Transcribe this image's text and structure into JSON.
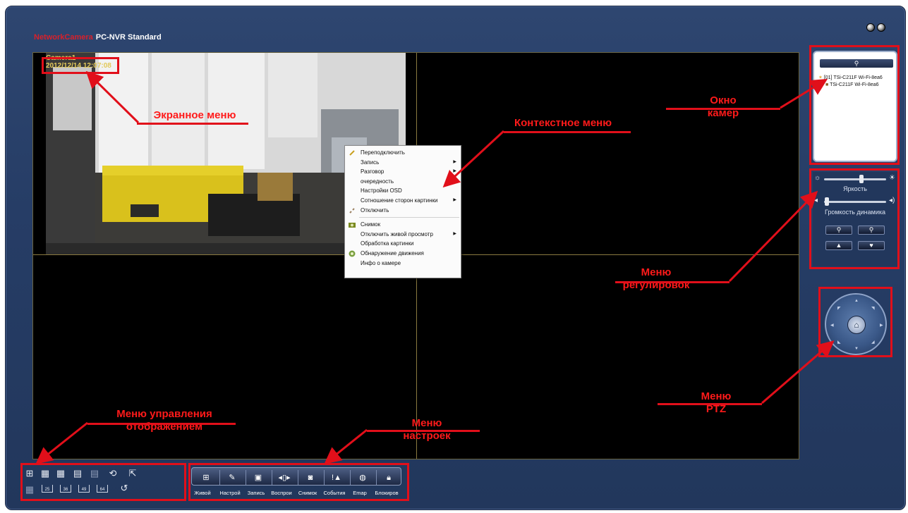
{
  "app": {
    "brand_red": "NetworkCamera",
    "brand_white": "PC-NVR Standard"
  },
  "osd": {
    "camera_name": "Camera1",
    "datetime": "2012/12/14 12:07:08"
  },
  "context_menu": {
    "items": [
      {
        "label": "Переподключить",
        "icon": "link-icon",
        "submenu": false
      },
      {
        "label": "Запись",
        "icon": "",
        "submenu": true
      },
      {
        "label": "Разговор",
        "icon": "",
        "submenu": true
      },
      {
        "label": "очередность",
        "icon": "",
        "submenu": true
      },
      {
        "label": "Настройки OSD",
        "icon": "",
        "submenu": false
      },
      {
        "label": "Сотношение сторон картинки",
        "icon": "",
        "submenu": true
      },
      {
        "label": "Отключить",
        "icon": "unlink-icon",
        "submenu": false
      },
      {
        "label": "Снимок",
        "icon": "camera-icon",
        "submenu": false
      },
      {
        "label": "Отключить живой просмотр",
        "icon": "",
        "submenu": true
      },
      {
        "label": "Обработка картинки",
        "icon": "",
        "submenu": false
      },
      {
        "label": "Обнаружение движения",
        "icon": "motion-icon",
        "submenu": false
      },
      {
        "label": "Инфо о камере",
        "icon": "",
        "submenu": false
      }
    ]
  },
  "camera_window": {
    "items": [
      {
        "label": "[01] TSi-C211F Wi-Fi-8ea6"
      },
      {
        "label": "TSi-C211F Wi-Fi-8ea6"
      }
    ]
  },
  "adjust": {
    "brightness_label": "Яркость",
    "brightness_level": 0.6,
    "volume_label": "Громкость динамика",
    "volume_level": 0.05
  },
  "layout_bar": {
    "labels": [
      "25",
      "36",
      "49",
      "64"
    ]
  },
  "settings_bar": {
    "labels": [
      "Живой",
      "Настрой",
      "Запись",
      "Воспрои",
      "Снимок",
      "События",
      "Emap",
      "Блокиров"
    ]
  },
  "annotations": {
    "osd_menu": "Экранное меню",
    "context_menu": "Контекстное меню",
    "camera_window": "Окно камер",
    "adjust_menu": "Меню регулировок",
    "ptz_menu": "Меню PTZ",
    "display_menu": "Меню управления отображением",
    "settings_menu": "Меню настроек"
  },
  "colors": {
    "annotation_red": "#e10f1a",
    "window_bg": "#263d66",
    "osd_text": "#e2c95a"
  }
}
